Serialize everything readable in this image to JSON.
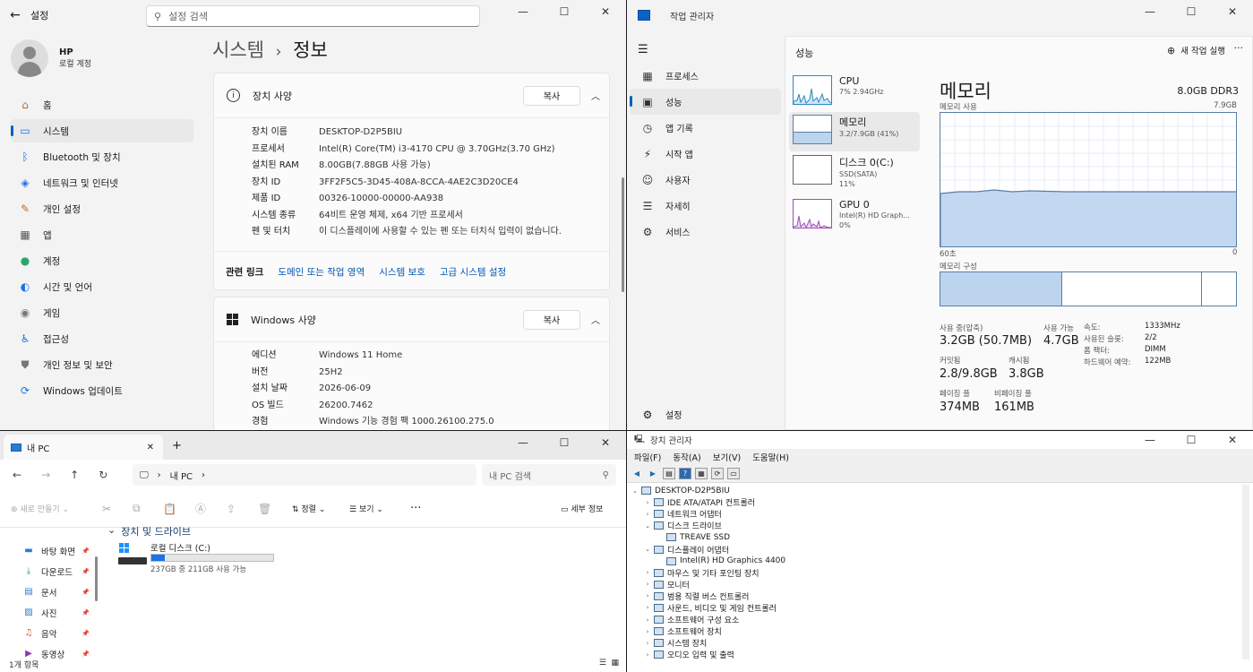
{
  "settings": {
    "app_title": "설정",
    "search_placeholder": "설정 검색",
    "profile": {
      "name": "HP",
      "type": "로컬 계정"
    },
    "nav": [
      {
        "label": "홈",
        "icon": "home-icon"
      },
      {
        "label": "시스템",
        "icon": "system-icon"
      },
      {
        "label": "Bluetooth 및 장치",
        "icon": "bluetooth-icon"
      },
      {
        "label": "네트워크 및 인터넷",
        "icon": "wifi-icon"
      },
      {
        "label": "개인 설정",
        "icon": "brush-icon"
      },
      {
        "label": "앱",
        "icon": "apps-icon"
      },
      {
        "label": "계정",
        "icon": "account-icon"
      },
      {
        "label": "시간 및 언어",
        "icon": "globe-icon"
      },
      {
        "label": "게임",
        "icon": "gamepad-icon"
      },
      {
        "label": "접근성",
        "icon": "accessibility-icon"
      },
      {
        "label": "개인 정보 및 보안",
        "icon": "shield-icon"
      },
      {
        "label": "Windows 업데이트",
        "icon": "update-icon"
      }
    ],
    "breadcrumb_parent": "시스템",
    "breadcrumb_sep": "›",
    "breadcrumb_current": "정보",
    "device_card": {
      "title": "장치 사양",
      "copy": "복사",
      "rows": [
        {
          "k": "장치 이름",
          "v": "DESKTOP-D2P5BIU"
        },
        {
          "k": "프로세서",
          "v": "Intel(R) Core(TM) i3-4170 CPU @ 3.70GHz(3.70 GHz)"
        },
        {
          "k": "설치된 RAM",
          "v": "8.00GB(7.88GB 사용 가능)"
        },
        {
          "k": "장치 ID",
          "v": "3FF2F5C5-3D45-408A-8CCA-4AE2C3D20CE4"
        },
        {
          "k": "제품 ID",
          "v": "00326-10000-00000-AA938"
        },
        {
          "k": "시스템 종류",
          "v": "64비트 운영 체제, x64 기반 프로세서"
        },
        {
          "k": "펜 및 터치",
          "v": "이 디스플레이에 사용할 수 있는 펜 또는 터치식 입력이 없습니다."
        }
      ],
      "links_label": "관련 링크",
      "links": [
        "도메인 또는 작업 영역",
        "시스템 보호",
        "고급 시스템 설정"
      ]
    },
    "windows_card": {
      "title": "Windows 사양",
      "copy": "복사",
      "rows": [
        {
          "k": "에디션",
          "v": "Windows 11 Home"
        },
        {
          "k": "버전",
          "v": "25H2"
        },
        {
          "k": "설치 날짜",
          "v": "2026-06-09"
        },
        {
          "k": "OS 빌드",
          "v": "26200.7462"
        },
        {
          "k": "경험",
          "v": "Windows 기능 경험 팩 1000.26100.275.0"
        }
      ]
    }
  },
  "taskmgr": {
    "app_title": "작업 관리자",
    "nav": [
      {
        "label": "프로세스",
        "icon": "processes-icon"
      },
      {
        "label": "성능",
        "icon": "performance-icon"
      },
      {
        "label": "앱 기록",
        "icon": "history-icon"
      },
      {
        "label": "시작 앱",
        "icon": "startup-icon"
      },
      {
        "label": "사용자",
        "icon": "users-icon"
      },
      {
        "label": "자세히",
        "icon": "details-icon"
      },
      {
        "label": "서비스",
        "icon": "services-icon"
      }
    ],
    "settings_label": "설정",
    "page_title": "성능",
    "new_task": "새 작업 실행",
    "more": "···",
    "perf_items": [
      {
        "name": "CPU",
        "sub1": "7% 2.94GHz",
        "sub2": ""
      },
      {
        "name": "메모리",
        "sub1": "3.2/7.9GB (41%)",
        "sub2": ""
      },
      {
        "name": "디스크 0(C:)",
        "sub1": "SSD(SATA)",
        "sub2": "11%"
      },
      {
        "name": "GPU 0",
        "sub1": "Intel(R) HD Graph...",
        "sub2": "0%"
      }
    ],
    "memory": {
      "title": "메모리",
      "capacity": "8.0GB DDR3",
      "usage_label": "메모리 사용",
      "usage_max": "7.9GB",
      "time_left": "60초",
      "time_right": "0",
      "usage_fraction": 0.41,
      "composition_label": "메모리 구성",
      "in_use_label": "사용 중(압축)",
      "in_use": "3.2GB (50.7MB)",
      "available_label": "사용 가능",
      "available": "4.7GB",
      "committed_label": "커밋됨",
      "committed": "2.8/9.8GB",
      "cached_label": "캐시됨",
      "cached": "3.8GB",
      "paged_label": "페이징 풀",
      "paged": "374MB",
      "nonpaged_label": "비페이징 풀",
      "nonpaged": "161MB",
      "speed_label": "속도:",
      "speed": "1333MHz",
      "slots_label": "사용된 슬롯:",
      "slots": "2/2",
      "form_label": "폼 팩터:",
      "form": "DIMM",
      "reserved_label": "하드웨어 예약:",
      "reserved": "122MB"
    }
  },
  "explorer": {
    "tab_title": "내 PC",
    "address": "내 PC",
    "search_placeholder": "내 PC 검색",
    "new_btn": "새로 만들기",
    "sort_btn": "정렬",
    "view_btn": "보기",
    "details_btn": "세부 정보",
    "quick_access": [
      {
        "label": "바탕 화면",
        "icon": "desktop-icon"
      },
      {
        "label": "다운로드",
        "icon": "download-icon"
      },
      {
        "label": "문서",
        "icon": "document-icon"
      },
      {
        "label": "사진",
        "icon": "pictures-icon"
      },
      {
        "label": "음악",
        "icon": "music-icon"
      },
      {
        "label": "동영상",
        "icon": "video-icon"
      }
    ],
    "section_title": "장치 및 드라이브",
    "drive_name": "로컬 디스크 (C:)",
    "drive_info": "237GB 중 211GB 사용 가능",
    "drive_used_fraction": 0.11,
    "status": "1개 항목"
  },
  "devmgr": {
    "app_title": "장치 관리자",
    "menu": [
      "파일(F)",
      "동작(A)",
      "보기(V)",
      "도움말(H)"
    ],
    "tree": [
      {
        "label": "DESKTOP-D2P5BIU",
        "level": 0,
        "tw": "⌄"
      },
      {
        "label": "IDE ATA/ATAPI 컨트롤러",
        "level": 1,
        "tw": "›"
      },
      {
        "label": "네트워크 어댑터",
        "level": 1,
        "tw": "›"
      },
      {
        "label": "디스크 드라이브",
        "level": 1,
        "tw": "⌄"
      },
      {
        "label": "TREAVE SSD",
        "level": 2,
        "tw": ""
      },
      {
        "label": "디스플레이 어댑터",
        "level": 1,
        "tw": "⌄"
      },
      {
        "label": "Intel(R) HD Graphics 4400",
        "level": 2,
        "tw": ""
      },
      {
        "label": "마우스 및 기타 포인팅 장치",
        "level": 1,
        "tw": "›"
      },
      {
        "label": "모니터",
        "level": 1,
        "tw": "›"
      },
      {
        "label": "범용 직렬 버스 컨트롤러",
        "level": 1,
        "tw": "›"
      },
      {
        "label": "사운드, 비디오 및 게임 컨트롤러",
        "level": 1,
        "tw": "›"
      },
      {
        "label": "소프트웨어 구성 요소",
        "level": 1,
        "tw": "›"
      },
      {
        "label": "소프트웨어 장치",
        "level": 1,
        "tw": "›"
      },
      {
        "label": "시스템 장치",
        "level": 1,
        "tw": "›"
      },
      {
        "label": "오디오 입력 및 출력",
        "level": 1,
        "tw": "›"
      }
    ]
  }
}
